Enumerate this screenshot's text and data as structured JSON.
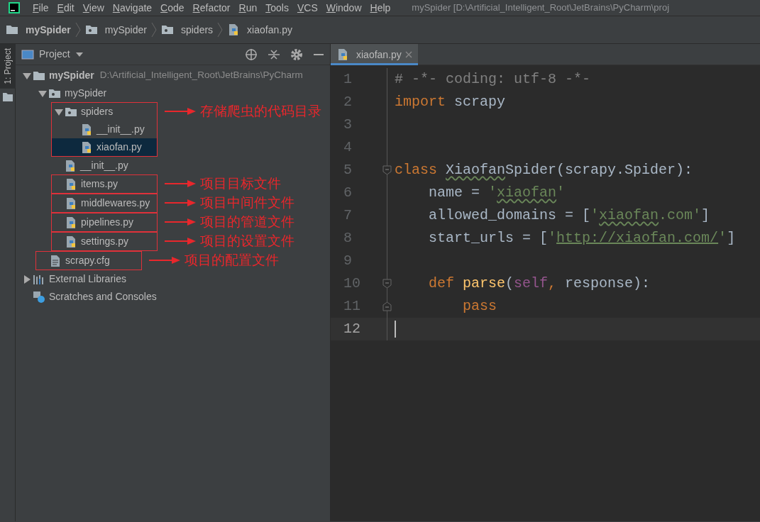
{
  "window": {
    "title": "mySpider [D:\\Artificial_Intelligent_Root\\JetBrains\\PyCharm\\proj"
  },
  "menu": [
    "File",
    "Edit",
    "View",
    "Navigate",
    "Code",
    "Refactor",
    "Run",
    "Tools",
    "VCS",
    "Window",
    "Help"
  ],
  "breadcrumbs": [
    {
      "label": "mySpider",
      "kind": "folder",
      "bold": true
    },
    {
      "label": "mySpider",
      "kind": "package",
      "bold": false
    },
    {
      "label": "spiders",
      "kind": "package",
      "bold": false
    },
    {
      "label": "xiaofan.py",
      "kind": "python",
      "bold": false
    }
  ],
  "side_tabs": [
    {
      "label": "1: Project",
      "selected": true
    }
  ],
  "project_panel": {
    "title": "Project",
    "tree": [
      {
        "label": "mySpider",
        "path": "D:\\Artificial_Intelligent_Root\\JetBrains\\PyCharm",
        "kind": "folder",
        "expanded": true,
        "selected": false,
        "children": [
          {
            "label": "mySpider",
            "kind": "package",
            "expanded": true,
            "selected": false,
            "children": [
              {
                "label": "spiders",
                "kind": "package",
                "expanded": true,
                "selected": false,
                "framed": true,
                "note": "存储爬虫的代码目录",
                "children": [
                  {
                    "label": "__init__.py",
                    "kind": "python",
                    "selected": false,
                    "framed": false
                  },
                  {
                    "label": "xiaofan.py",
                    "kind": "python",
                    "selected": true,
                    "framed": false
                  }
                ]
              },
              {
                "label": "__init__.py",
                "kind": "python",
                "selected": false,
                "framed": false
              },
              {
                "label": "items.py",
                "kind": "python",
                "selected": false,
                "framed": true,
                "note": "项目目标文件"
              },
              {
                "label": "middlewares.py",
                "kind": "python",
                "selected": false,
                "framed": true,
                "note": "项目中间件文件"
              },
              {
                "label": "pipelines.py",
                "kind": "python",
                "selected": false,
                "framed": true,
                "note": "项目的管道文件"
              },
              {
                "label": "settings.py",
                "kind": "python",
                "selected": false,
                "framed": true,
                "note": "项目的设置文件"
              }
            ]
          },
          {
            "label": "scrapy.cfg",
            "kind": "text",
            "selected": false,
            "framed": true,
            "note": "项目的配置文件"
          }
        ]
      },
      {
        "label": "External Libraries",
        "kind": "libraries",
        "expanded": false,
        "selected": false
      },
      {
        "label": "Scratches and Consoles",
        "kind": "scratches",
        "selected": false
      }
    ]
  },
  "editor": {
    "tabs": [
      {
        "label": "xiaofan.py",
        "selected": true
      }
    ],
    "lines": [
      {
        "number": "1",
        "current": false,
        "kind": "code",
        "tokens": [
          {
            "kind": "comment",
            "text": "# -*- coding: utf-8 -*-"
          }
        ]
      },
      {
        "number": "2",
        "current": false,
        "kind": "code",
        "tokens": [
          {
            "kind": "keyword",
            "text": "import"
          },
          {
            "kind": "plain",
            "text": " scrapy"
          }
        ]
      },
      {
        "number": "3",
        "current": false,
        "kind": "code"
      },
      {
        "number": "4",
        "current": false,
        "kind": "code"
      },
      {
        "number": "5",
        "current": false,
        "kind": "fold-start",
        "tokens": [
          {
            "kind": "keyword",
            "text": "class "
          },
          {
            "kind": "typo",
            "text": "Xiaofan"
          },
          {
            "kind": "plain",
            "text": "Spider(scrapy.Spider):"
          }
        ]
      },
      {
        "number": "6",
        "current": false,
        "kind": "code",
        "tokens": [
          {
            "kind": "plain",
            "text": "    name = "
          },
          {
            "kind": "string",
            "text": "'"
          },
          {
            "kind": "string-typo",
            "text": "xiaofan"
          },
          {
            "kind": "string",
            "text": "'"
          }
        ]
      },
      {
        "number": "7",
        "current": false,
        "kind": "code",
        "tokens": [
          {
            "kind": "plain",
            "text": "    allowed_domains = ["
          },
          {
            "kind": "string",
            "text": "'"
          },
          {
            "kind": "string-typo",
            "text": "xiaofan"
          },
          {
            "kind": "string",
            "text": ".com'"
          },
          {
            "kind": "plain",
            "text": "]"
          }
        ]
      },
      {
        "number": "8",
        "current": false,
        "kind": "code",
        "tokens": [
          {
            "kind": "plain",
            "text": "    start_urls = ["
          },
          {
            "kind": "string",
            "text": "'"
          },
          {
            "kind": "link",
            "text": "http://xiaofan.com/"
          },
          {
            "kind": "string",
            "text": "'"
          },
          {
            "kind": "plain",
            "text": "]"
          }
        ]
      },
      {
        "number": "9",
        "current": false,
        "kind": "code"
      },
      {
        "number": "10",
        "current": false,
        "kind": "fold-start",
        "tokens": [
          {
            "kind": "keyword",
            "text": "    def "
          },
          {
            "kind": "func",
            "text": "parse"
          },
          {
            "kind": "plain",
            "text": "("
          },
          {
            "kind": "self",
            "text": "self"
          },
          {
            "kind": "keyword",
            "text": ","
          },
          {
            "kind": "plain",
            "text": " response):"
          }
        ]
      },
      {
        "number": "11",
        "current": false,
        "kind": "fold-end",
        "tokens": [
          {
            "kind": "keyword",
            "text": "        pass"
          }
        ]
      },
      {
        "number": "12",
        "current": true,
        "kind": "code"
      }
    ]
  }
}
